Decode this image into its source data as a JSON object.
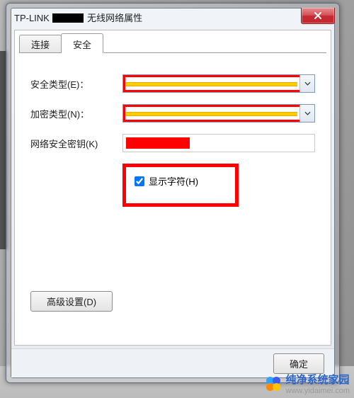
{
  "window": {
    "title_prefix": "TP-LINK",
    "title_suffix": "无线网络属性",
    "close_glyph": "X"
  },
  "tabs": {
    "connection": "连接",
    "security": "安全"
  },
  "labels": {
    "security_type": "安全类型(E)：",
    "encryption_type": "加密类型(N)：",
    "network_key": "网络安全密钥(K)",
    "show_chars": "显示字符(H)",
    "advanced": "高级设置(D)"
  },
  "footer": {
    "ok": "确定"
  },
  "watermark": {
    "name": "纯净系统家园",
    "url": "www.yidaimei.com"
  },
  "colors": {
    "highlight_border": "#ff0000",
    "mask_bar": "#ffcc00",
    "close_red": "#c62a32"
  }
}
